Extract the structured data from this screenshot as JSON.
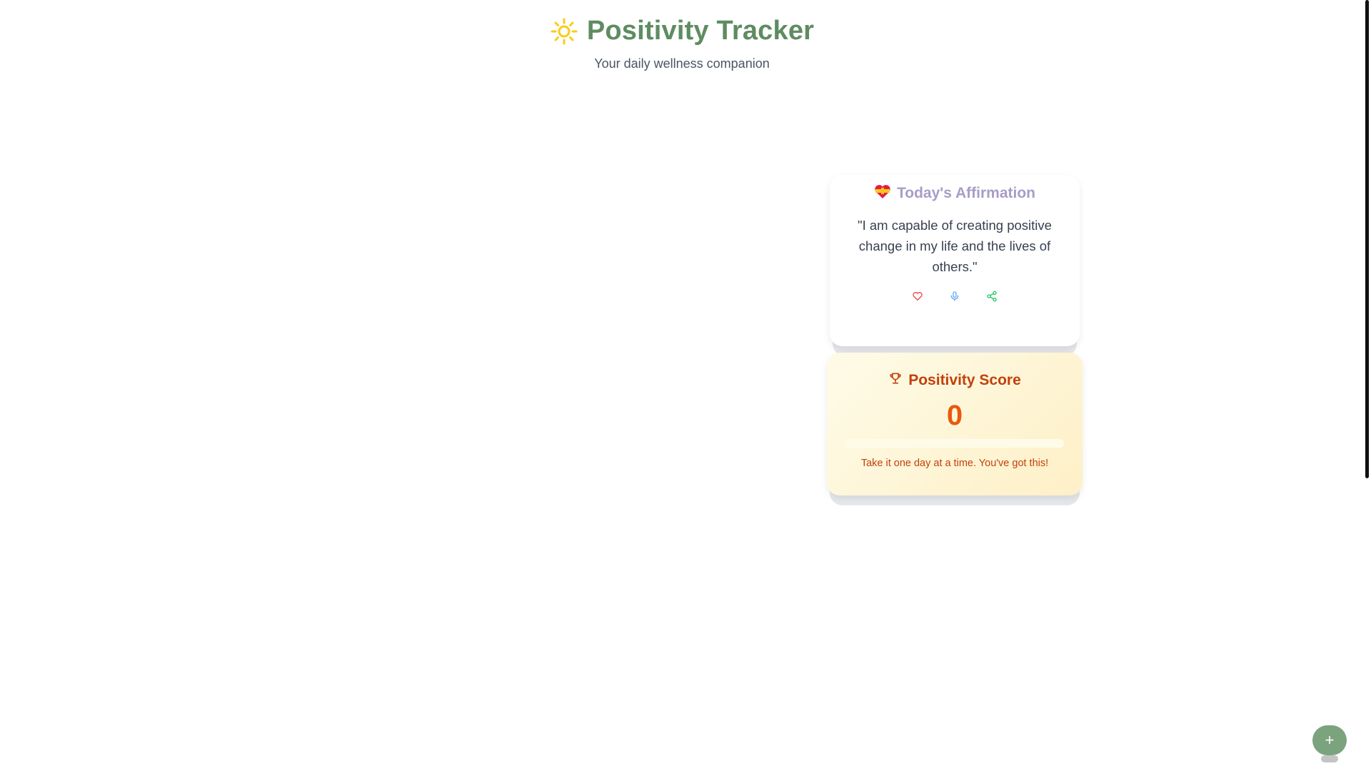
{
  "header": {
    "title": "Positivity Tracker",
    "subtitle": "Your daily wellness companion",
    "icon": "sun-icon"
  },
  "affirmation": {
    "title": "Today's Affirmation",
    "icon": "heart-ribbon-icon",
    "text": "\"I am capable of creating positive change in my life and the lives of others.\"",
    "actions": [
      {
        "name": "like",
        "icon": "heart-icon",
        "color": "#ef4444"
      },
      {
        "name": "listen",
        "icon": "microphone-icon",
        "color": "#60a5fa"
      },
      {
        "name": "share",
        "icon": "share-icon",
        "color": "#22c55e"
      }
    ]
  },
  "score": {
    "title": "Positivity Score",
    "icon": "trophy-icon",
    "value": "0",
    "progress_percent": 0,
    "message": "Take it one day at a time. You've got this!"
  },
  "fab": {
    "label": "+",
    "color": "#7ba37d"
  },
  "colors": {
    "brand": "#5e8c61",
    "accent": "#ea580c",
    "sun": "#facc15"
  }
}
